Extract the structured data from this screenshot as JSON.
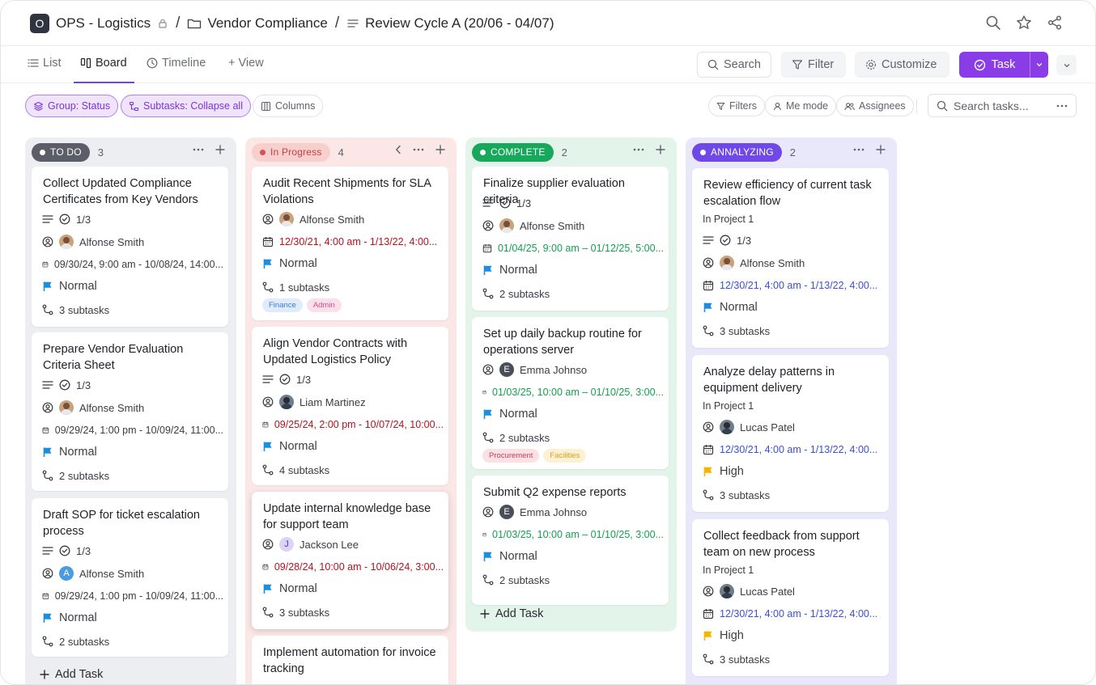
{
  "breadcrumb": {
    "workspace_initial": "O",
    "workspace": "OPS - Logistics",
    "folder": "Vendor Compliance",
    "list": "Review Cycle A (20/06 - 04/07)"
  },
  "views": {
    "list": "List",
    "board": "Board",
    "timeline": "Timeline",
    "add_view": "+ View",
    "search": "Search",
    "filter": "Filter",
    "customize": "Customize",
    "task": "Task"
  },
  "toolbar": {
    "group": "Group: Status",
    "subtasks": "Subtasks: Collapse all",
    "columns": "Columns",
    "filters": "Filters",
    "me_mode": "Me mode",
    "assignees": "Assignees",
    "search_placeholder": "Search tasks..."
  },
  "columns": [
    {
      "status": "TO DO",
      "count": "3",
      "cards": [
        {
          "title": "Collect Updated Compliance Certificates from Key Vendors",
          "checklist": "1/3",
          "assignee": "Alfonse Smith",
          "date": "09/30/24, 9:00 am - 10/08/24, 14:00...",
          "priority": "Normal",
          "subtasks": "3 subtasks"
        },
        {
          "title": "Prepare Vendor Evaluation Criteria Sheet",
          "checklist": "1/3",
          "assignee": "Alfonse Smith",
          "date": "09/29/24, 1:00 pm - 10/09/24, 11:00...",
          "priority": "Normal",
          "subtasks": "2 subtasks"
        },
        {
          "title": "Draft SOP for ticket escalation process",
          "checklist": "1/3",
          "assignee": "Alfonse Smith",
          "avatar_letter": "A",
          "date": "09/29/24, 1:00 pm - 10/09/24, 11:00...",
          "priority": "Normal",
          "subtasks": "2 subtasks"
        }
      ],
      "add_task": "Add Task"
    },
    {
      "status": "In Progress",
      "count": "4",
      "cards": [
        {
          "title": "Audit Recent Shipments for SLA Violations",
          "assignee": "Alfonse Smith",
          "date": "12/30/21, 4:00 am - 1/13/22, 4:00...",
          "priority": "Normal",
          "subtasks": "1 subtasks",
          "tags": [
            "Finance",
            "Admin"
          ]
        },
        {
          "title": "Align Vendor Contracts with Updated Logistics Policy",
          "checklist": "1/3",
          "assignee": "Liam Martinez",
          "date": "09/25/24, 2:00 pm - 10/07/24, 10:00...",
          "priority": "Normal",
          "subtasks": "4 subtasks"
        },
        {
          "title": "Update internal knowledge base for support team",
          "assignee": "Jackson Lee",
          "avatar_letter": "J",
          "date": "09/28/24, 10:00 am - 10/06/24, 3:00...",
          "priority": "Normal",
          "subtasks": "3 subtasks"
        },
        {
          "title": "Implement automation for invoice tracking"
        }
      ]
    },
    {
      "status": "COMPLETE",
      "count": "2",
      "cards": [
        {
          "title": "Finalize supplier evaluation criteria",
          "checklist": "1/3",
          "assignee": "Alfonse Smith",
          "date": "01/04/25, 9:00 am – 01/12/25, 5:00...",
          "priority": "Normal",
          "subtasks": "2 subtasks"
        },
        {
          "title": "Set up daily backup routine for operations server",
          "assignee": "Emma Johnso",
          "avatar_letter": "E",
          "date": "01/03/25, 10:00 am – 01/10/25, 3:00...",
          "priority": "Normal",
          "subtasks": "2 subtasks",
          "tags": [
            "Procurement",
            "Facilities"
          ]
        },
        {
          "title": "Submit Q2 expense reports",
          "assignee": "Emma Johnso",
          "avatar_letter": "E",
          "date": "01/03/25, 10:00 am – 01/10/25, 3:00...",
          "priority": "Normal",
          "subtasks": "2 subtasks"
        }
      ],
      "add_task": "Add Task"
    },
    {
      "status": "ANNALYZING",
      "count": "2",
      "cards": [
        {
          "title": "Review efficiency of current task escalation flow",
          "project": "In Project 1",
          "checklist": "1/3",
          "assignee": "Alfonse Smith",
          "date": "12/30/21, 4:00 am - 1/13/22, 4:00...",
          "priority": "Normal",
          "subtasks": "3 subtasks"
        },
        {
          "title": "Analyze delay patterns in equipment delivery",
          "project": "In Project 1",
          "assignee": "Lucas Patel",
          "date": "12/30/21, 4:00 am - 1/13/22, 4:00...",
          "priority": "High",
          "subtasks": "3 subtasks"
        },
        {
          "title": "Collect feedback from support team on new process",
          "project": "In Project 1",
          "assignee": "Lucas Patel",
          "date": "12/30/21, 4:00 am - 1/13/22, 4:00...",
          "priority": "High",
          "subtasks": "3 subtasks"
        }
      ]
    }
  ],
  "colors": {
    "accent": "#8a3ce6",
    "flag_normal": "#1a8fe0",
    "flag_high": "#f5b400",
    "date_overdue": "#b3121f",
    "date_done": "#12a150",
    "date_future": "#3d4fd2"
  }
}
